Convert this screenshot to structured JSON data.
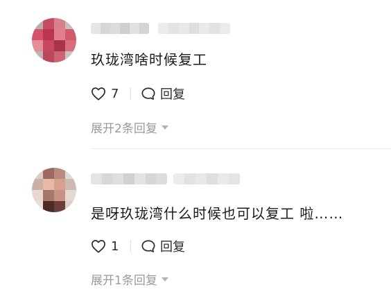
{
  "comments": [
    {
      "text": "玖珑湾啥时候复工",
      "likes": "7",
      "reply_label": "回复",
      "expand_label": "展开2条回复"
    },
    {
      "text": "是呀玖珑湾什么时候也可以复工 啦……",
      "likes": "1",
      "reply_label": "回复",
      "expand_label": "展开1条回复"
    }
  ],
  "colors": {
    "text": "#1a1a1a",
    "muted": "#9a9a9a",
    "divider": "#ececec",
    "avatar1": [
      "#c8485c",
      "#d96a7a",
      "#b83a52",
      "#e48d96"
    ],
    "avatar2": [
      "#c9b0a4",
      "#8a5b52",
      "#e7d8d0",
      "#4e2a26"
    ]
  },
  "icons": [
    "heart-icon",
    "comment-bubble-icon",
    "caret-down-icon"
  ]
}
